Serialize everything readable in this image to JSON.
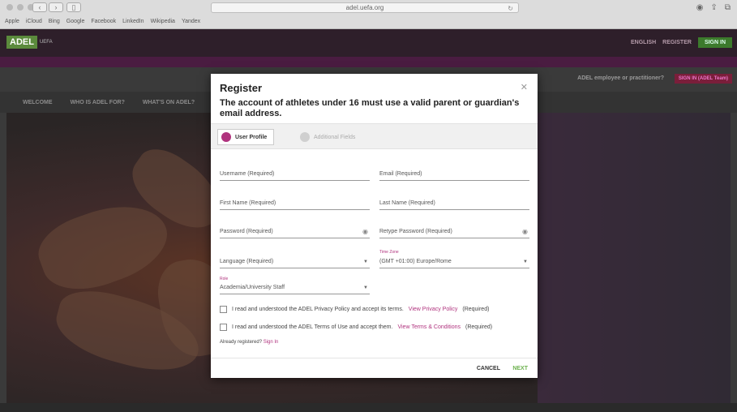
{
  "browser": {
    "url": "adel.uefa.org",
    "bookmarks": [
      "Apple",
      "iCloud",
      "Bing",
      "Google",
      "Facebook",
      "LinkedIn",
      "Wikipedia",
      "Yandex"
    ]
  },
  "site": {
    "logo": "ADEL",
    "logo_sub": "UEFA",
    "language": "ENGLISH",
    "register": "REGISTER",
    "sign_in": "SIGN IN",
    "employee_question": "ADEL employee or practitioner?",
    "employee_button": "SIGN IN (ADEL Team)",
    "tabs": [
      "WELCOME",
      "WHO IS ADEL FOR?",
      "WHAT'S ON ADEL?"
    ]
  },
  "modal": {
    "title": "Register",
    "warning": "The account of athletes under 16 must use a valid parent or guardian's email address.",
    "steps": {
      "active": "User Profile",
      "inactive": "Additional Fields"
    },
    "fields": {
      "username": "Username (Required)",
      "email": "Email (Required)",
      "first_name": "First Name (Required)",
      "last_name": "Last Name (Required)",
      "password": "Password (Required)",
      "retype_password": "Retype Password (Required)",
      "language": "Language (Required)",
      "timezone_label": "Time Zone",
      "timezone": "(GMT +01:00) Europe/Rome",
      "role_label": "Role",
      "role": "Academia/University Staff"
    },
    "privacy": {
      "text": "I read and understood the ADEL Privacy Policy and accept its terms.",
      "link": "View Privacy Policy",
      "required": "(Required)"
    },
    "terms": {
      "text": "I read and understood the ADEL Terms of Use and accept them.",
      "link": "View Terms & Conditions",
      "required": "(Required)"
    },
    "already": {
      "text": "Already registered?",
      "link": "Sign In"
    },
    "cancel": "CANCEL",
    "next": "NEXT"
  }
}
